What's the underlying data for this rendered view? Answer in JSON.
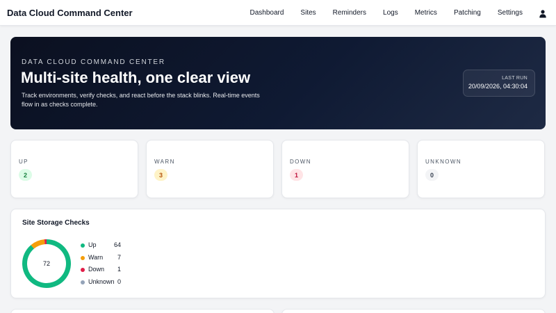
{
  "app": {
    "title": "Data Cloud Command Center"
  },
  "nav": {
    "items": [
      {
        "label": "Dashboard"
      },
      {
        "label": "Sites"
      },
      {
        "label": "Reminders"
      },
      {
        "label": "Logs"
      },
      {
        "label": "Metrics"
      },
      {
        "label": "Patching"
      },
      {
        "label": "Settings"
      }
    ],
    "user_icon": "user-icon"
  },
  "hero": {
    "eyebrow": "DATA CLOUD COMMAND CENTER",
    "title": "Multi-site health, one clear view",
    "description": "Track environments, verify checks, and react before the stack blinks. Real-time events flow in as checks complete.",
    "last_run_label": "LAST RUN",
    "last_run_value": "20/09/2026, 04:30:04"
  },
  "stats": [
    {
      "label": "UP",
      "value": "2",
      "color": "#15803d",
      "bg": "#dcfce7"
    },
    {
      "label": "WARN",
      "value": "3",
      "color": "#b45309",
      "bg": "#fef3c7"
    },
    {
      "label": "DOWN",
      "value": "1",
      "color": "#be123c",
      "bg": "#ffe4e6"
    },
    {
      "label": "UNKNOWN",
      "value": "0",
      "color": "#374151",
      "bg": "#f3f4f6"
    }
  ],
  "storage": {
    "title": "Site Storage Checks",
    "total": "72",
    "legend": [
      {
        "label": "Up",
        "value": 64,
        "color": "#10b981"
      },
      {
        "label": "Warn",
        "value": 7,
        "color": "#f59e0b"
      },
      {
        "label": "Down",
        "value": 1,
        "color": "#e11d48"
      },
      {
        "label": "Unknown",
        "value": 0,
        "color": "#94a3b8"
      }
    ]
  }
}
